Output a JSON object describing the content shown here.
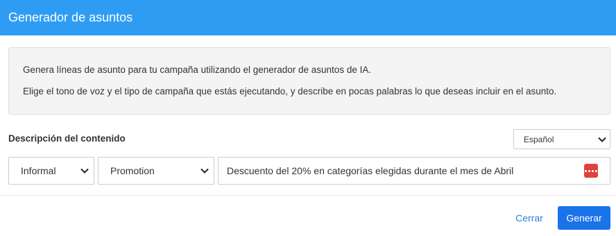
{
  "dialog": {
    "title": "Generador de asuntos"
  },
  "info": {
    "line1": "Genera líneas de asunto para tu campaña utilizando el generador de asuntos de IA.",
    "line2": "Elige el tono de voz y el tipo de campaña que estás ejecutando, y describe en pocas palabras lo que deseas incluir en el asunto."
  },
  "content": {
    "label": "Descripción del contenido",
    "language": {
      "selected": "Español",
      "icon": "chevron-down-icon"
    },
    "tone": {
      "selected": "Informal",
      "icon": "chevron-down-icon"
    },
    "campaign_type": {
      "selected": "Promotion",
      "icon": "chevron-down-icon"
    },
    "description": {
      "value": "Descuento del 20% en categorías elegidas durante el mes de Abril",
      "icon": "password-dots-icon",
      "icon_color": "#e0423b"
    }
  },
  "footer": {
    "close_label": "Cerrar",
    "generate_label": "Generar"
  },
  "colors": {
    "header": "#2f9cf4",
    "primary_button": "#1a73e8",
    "link": "#2f7fd8"
  }
}
